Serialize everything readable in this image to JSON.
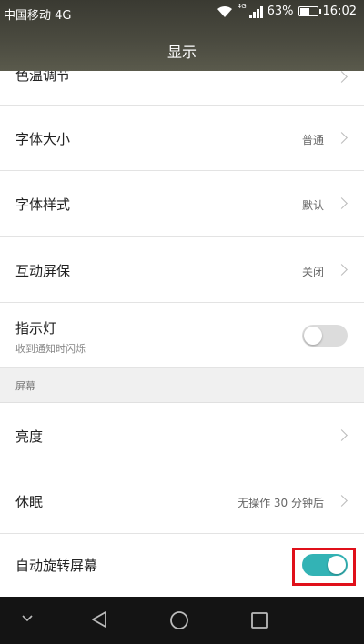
{
  "status_bar": {
    "carrier": "中国移动 4G",
    "signal_label": "4G",
    "battery_percent": "63%",
    "battery_level": 0.63,
    "time": "16:02",
    "icons": [
      "wifi-icon",
      "signal-icon",
      "battery-icon"
    ]
  },
  "header": {
    "title": "显示"
  },
  "settings": {
    "color_temp": {
      "label": "色温调节"
    },
    "font_size": {
      "label": "字体大小",
      "value": "普通"
    },
    "font_style": {
      "label": "字体样式",
      "value": "默认"
    },
    "screensaver": {
      "label": "互动屏保",
      "value": "关闭"
    },
    "indicator": {
      "label": "指示灯",
      "sublabel": "收到通知时闪烁",
      "enabled": false
    },
    "section_screen": "屏幕",
    "brightness": {
      "label": "亮度"
    },
    "sleep": {
      "label": "休眠",
      "value": "无操作 30 分钟后"
    },
    "auto_rotate": {
      "label": "自动旋转屏幕",
      "enabled": true
    }
  },
  "nav_bar": {
    "icons": [
      "collapse-icon",
      "back-icon",
      "home-icon",
      "recents-icon"
    ]
  },
  "colors": {
    "toggle_on": "#33b3b5",
    "toggle_off": "#dcdcdc",
    "highlight": "#e0101a",
    "header_bg": "#4b4b40"
  }
}
